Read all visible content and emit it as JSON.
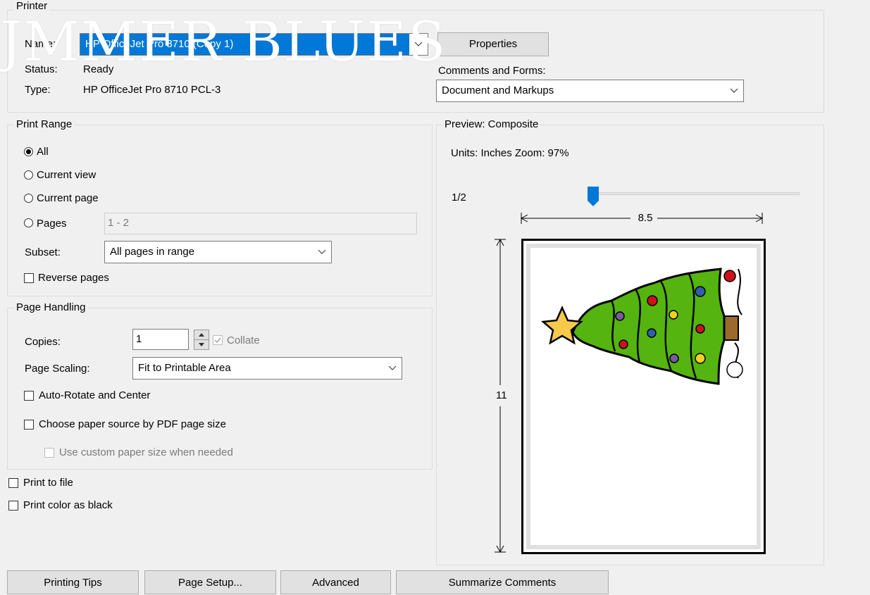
{
  "printer": {
    "group_label": "Printer",
    "name_label": "Name:",
    "name_value": "HP OfficeJet Pro 8710 (Copy 1)",
    "status_label": "Status:",
    "status_value": "Ready",
    "type_label": "Type:",
    "type_value": "HP OfficeJet Pro 8710 PCL-3",
    "properties_button": "Properties",
    "comments_label": "Comments and Forms:",
    "comments_value": "Document and Markups"
  },
  "overlay": {
    "text": "JMMER BLUES"
  },
  "print_range": {
    "group_label": "Print Range",
    "options": [
      {
        "label": "All",
        "selected": true
      },
      {
        "label": "Current view",
        "selected": false
      },
      {
        "label": "Current page",
        "selected": false
      },
      {
        "label": "Pages",
        "selected": false
      }
    ],
    "pages_value": "1 - 2",
    "subset_label": "Subset:",
    "subset_value": "All pages in range",
    "reverse_label": "Reverse pages"
  },
  "page_handling": {
    "group_label": "Page Handling",
    "copies_label": "Copies:",
    "copies_value": "1",
    "collate_label": "Collate",
    "scaling_label": "Page Scaling:",
    "scaling_value": "Fit to Printable Area",
    "auto_rotate_label": "Auto-Rotate and Center",
    "paper_source_label": "Choose paper source by PDF page size",
    "custom_paper_label": "Use custom paper size when needed"
  },
  "options": {
    "print_to_file": "Print to file",
    "print_color_black": "Print color as black"
  },
  "preview": {
    "group_label": "Preview: Composite",
    "units_zoom": "Units: Inches Zoom:  97%",
    "page_indicator": "1/2",
    "width_label": "8.5",
    "height_label": "11",
    "slider_position": 0.0
  },
  "footer": {
    "buttons": [
      "Printing Tips",
      "Page Setup...",
      "Advanced",
      "Summarize Comments"
    ]
  },
  "colors": {
    "selection_blue": "#0078d7",
    "tree_green": "#55b40f",
    "ornament_red": "#d0101a",
    "star_yellow": "#f7c948"
  }
}
